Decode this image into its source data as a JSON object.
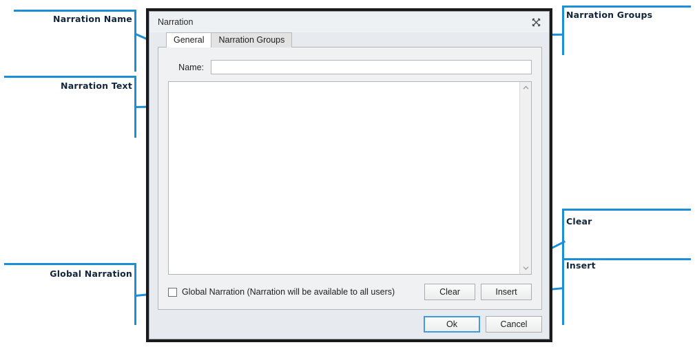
{
  "dialog": {
    "title": "Narration",
    "close_icon": "close-x-icon",
    "tabs": [
      {
        "label": "General",
        "active": true
      },
      {
        "label": "Narration Groups",
        "active": false
      }
    ],
    "name_field": {
      "label": "Name:",
      "value": "",
      "placeholder": ""
    },
    "narration_text": {
      "value": "",
      "placeholder": ""
    },
    "scrollbar": {
      "up_icon": "chevron-up-icon",
      "down_icon": "chevron-down-icon"
    },
    "global_narration": {
      "label": "Global Narration (Narration will be available to all users)",
      "checked": false
    },
    "buttons": {
      "clear": "Clear",
      "insert": "Insert",
      "ok": "Ok",
      "cancel": "Cancel"
    }
  },
  "annotations": [
    {
      "id": "narration-name",
      "label": "Narration Name"
    },
    {
      "id": "narration-text",
      "label": "Narration Text"
    },
    {
      "id": "global-narration",
      "label": "Global Narration"
    },
    {
      "id": "narration-groups",
      "label": "Narration Groups"
    },
    {
      "id": "clear",
      "label": "Clear"
    },
    {
      "id": "insert",
      "label": "Insert"
    }
  ],
  "colors": {
    "accent": "#1b8ed6",
    "label_text": "#11263b",
    "dialog_border": "#1a1a1a",
    "default_button_border": "#3f9ade"
  }
}
